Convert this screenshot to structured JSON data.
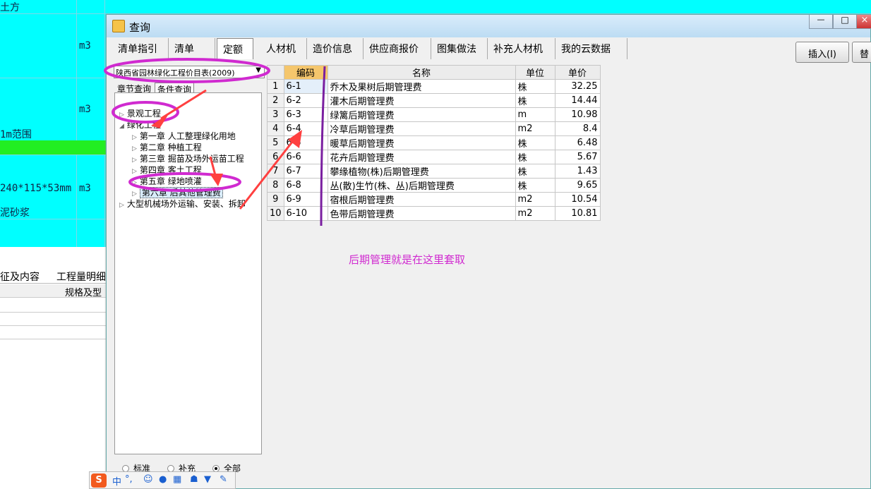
{
  "background": {
    "row1": "土方",
    "unit1": "m3",
    "unit2": "m3",
    "row3": "1m范围",
    "row4": "240*115*53mm",
    "unit4": "m3",
    "row5": "泥砂浆",
    "tab_features": "征及内容",
    "tab_quantity": "工程量明细",
    "col_spec": "规格及型"
  },
  "window": {
    "title": "查询",
    "minimize": "—",
    "maximize": "□",
    "close": "×"
  },
  "tabs": [
    "清单指引",
    "清单",
    "定额",
    "人材机",
    "造价信息",
    "供应商报价",
    "图集做法",
    "补充人材机",
    "我的云数据"
  ],
  "buttons": {
    "insert": "插入(I)",
    "replace": "替"
  },
  "dropdown": {
    "value": "陕西省园林绿化工程价目表(2009)"
  },
  "subtabs": {
    "chapter": "章节查询",
    "condition": "条件查询"
  },
  "tree": [
    {
      "label": "景观工程"
    },
    {
      "label": "绿化工程"
    },
    {
      "label": "第一章 人工整理绿化用地"
    },
    {
      "label": "第二章 种植工程"
    },
    {
      "label": "第三章 掘苗及场外运苗工程"
    },
    {
      "label": "第四章 客土工程"
    },
    {
      "label": "第五章 绿地喷灌"
    },
    {
      "label": "第六章 后其他管理费"
    },
    {
      "label": "大型机械场外运输、安装、拆卸"
    }
  ],
  "radios": [
    "标准",
    "补充",
    "全部"
  ],
  "table": {
    "headers": [
      "编码",
      "名称",
      "单位",
      "单价"
    ],
    "rows": [
      {
        "n": "1",
        "code": "6-1",
        "name": "乔木及果树后期管理费",
        "unit": "株",
        "price": "32.25"
      },
      {
        "n": "2",
        "code": "6-2",
        "name": "灌木后期管理费",
        "unit": "株",
        "price": "14.44"
      },
      {
        "n": "3",
        "code": "6-3",
        "name": "绿篱后期管理费",
        "unit": "m",
        "price": "10.98"
      },
      {
        "n": "4",
        "code": "6-4",
        "name": "冷草后期管理费",
        "unit": "m2",
        "price": "8.4"
      },
      {
        "n": "5",
        "code": "6-5",
        "name": "暖草后期管理费",
        "unit": "株",
        "price": "6.48"
      },
      {
        "n": "6",
        "code": "6-6",
        "name": "花卉后期管理费",
        "unit": "株",
        "price": "5.67"
      },
      {
        "n": "7",
        "code": "6-7",
        "name": "攀缘植物(株)后期管理费",
        "unit": "株",
        "price": "1.43"
      },
      {
        "n": "8",
        "code": "6-8",
        "name": "丛(散)生竹(株、丛)后期管理费",
        "unit": "株",
        "price": "9.65"
      },
      {
        "n": "9",
        "code": "6-9",
        "name": "宿根后期管理费",
        "unit": "m2",
        "price": "10.54"
      },
      {
        "n": "10",
        "code": "6-10",
        "name": "色带后期管理费",
        "unit": "m2",
        "price": "10.81"
      }
    ]
  },
  "annotation_note": "后期管理就是在这里套取",
  "ime": {
    "logo": "S",
    "mode": "中",
    "punct": "°,",
    "icons": [
      "smile-icon",
      "mic-icon",
      "keyboard-icon",
      "user-icon",
      "shirt-icon",
      "wrench-icon"
    ]
  },
  "colors": {
    "annotation": "#d02ad0",
    "header_highlight": "#f5c66c",
    "arrow": "#ff4040",
    "purple_line": "#7a1fa0"
  }
}
